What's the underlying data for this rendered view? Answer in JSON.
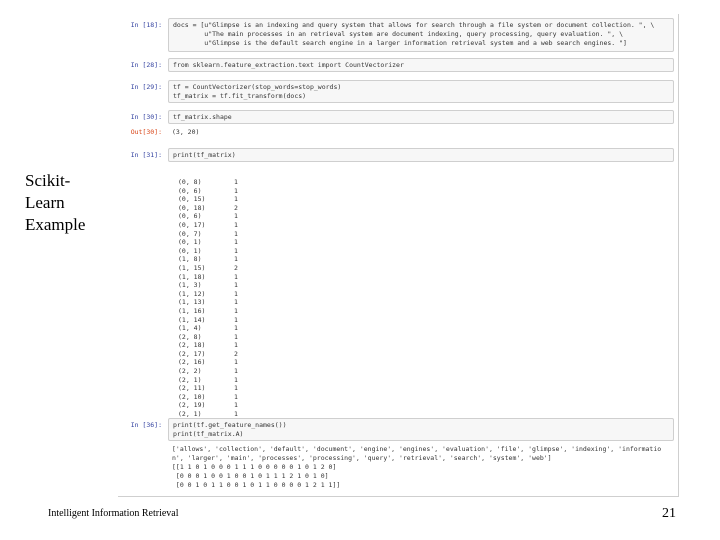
{
  "slide": {
    "title": "Scikit-\nLearn\nExample",
    "footer_text": "Intelligent Information Retrieval",
    "page_number": "21"
  },
  "cells": {
    "docs": {
      "prompt": "In [18]:",
      "lines": [
        "docs = [u\"Glimpse is an indexing and query system that allows for search through a file system or document collection. \", \\",
        "        u\"The main processes in an retrieval system are document indexing, query processing, query evaluation. \", \\",
        "        u\"Glimpse is the default search engine in a larger information retrieval system and a web search engines. \"]"
      ]
    },
    "import": {
      "prompt": "In [28]:",
      "lines": [
        "from sklearn.feature_extraction.text import CountVectorizer"
      ]
    },
    "vectorize": {
      "prompt": "In [29]:",
      "lines": [
        "tf = CountVectorizer(stop_words=stop_words)",
        "tf_matrix = tf.fit_transform(docs)"
      ]
    },
    "shape": {
      "prompt": "In [30]:",
      "lines": [
        "tf_matrix.shape"
      ],
      "out_prompt": "Out[30]:",
      "output": "(3, 20)"
    },
    "print_matrix": {
      "prompt": "In [31]:",
      "lines": [
        "print(tf_matrix)"
      ],
      "output_rows": [
        {
          "coord": "(0, 8)",
          "value": "1"
        },
        {
          "coord": "(0, 6)",
          "value": "1"
        },
        {
          "coord": "(0, 15)",
          "value": "1"
        },
        {
          "coord": "(0, 18)",
          "value": "2"
        },
        {
          "coord": "(0, 6)",
          "value": "1"
        },
        {
          "coord": "(0, 17)",
          "value": "1"
        },
        {
          "coord": "(0, 7)",
          "value": "1"
        },
        {
          "coord": "(0, 1)",
          "value": "1"
        },
        {
          "coord": "(0, 1)",
          "value": "1"
        },
        {
          "coord": "(1, 8)",
          "value": "1"
        },
        {
          "coord": "(1, 15)",
          "value": "2"
        },
        {
          "coord": "(1, 18)",
          "value": "1"
        },
        {
          "coord": "(1, 3)",
          "value": "1"
        },
        {
          "coord": "(1, 12)",
          "value": "1"
        },
        {
          "coord": "(1, 13)",
          "value": "1"
        },
        {
          "coord": "(1, 16)",
          "value": "1"
        },
        {
          "coord": "(1, 14)",
          "value": "1"
        },
        {
          "coord": "(1, 4)",
          "value": "1"
        },
        {
          "coord": "(2, 8)",
          "value": "1"
        },
        {
          "coord": "(2, 18)",
          "value": "1"
        },
        {
          "coord": "(2, 17)",
          "value": "2"
        },
        {
          "coord": "(2, 16)",
          "value": "1"
        },
        {
          "coord": "(2, 2)",
          "value": "1"
        },
        {
          "coord": "(2, 1)",
          "value": "1"
        },
        {
          "coord": "(2, 11)",
          "value": "1"
        },
        {
          "coord": "(2, 10)",
          "value": "1"
        },
        {
          "coord": "(2, 19)",
          "value": "1"
        },
        {
          "coord": "(2, 1)",
          "value": "1"
        }
      ]
    },
    "features": {
      "prompt": "In [36]:",
      "lines": [
        "print(tf.get_feature_names())",
        "print(tf_matrix.A)"
      ],
      "output": [
        "['allows', 'collection', 'default', 'document', 'engine', 'engines', 'evaluation', 'file', 'glimpse', 'indexing', 'informatio",
        "n', 'larger', 'main', 'processes', 'processing', 'query', 'retrieval', 'search', 'system', 'web']",
        "[[1 1 0 1 0 0 0 1 1 1 0 0 0 0 0 1 0 1 2 0]",
        " [0 0 0 1 0 0 1 0 0 1 0 1 1 1 2 1 0 1 0]",
        " [0 0 1 0 1 1 0 0 1 0 1 1 0 0 0 0 1 2 1 1]]"
      ]
    }
  }
}
